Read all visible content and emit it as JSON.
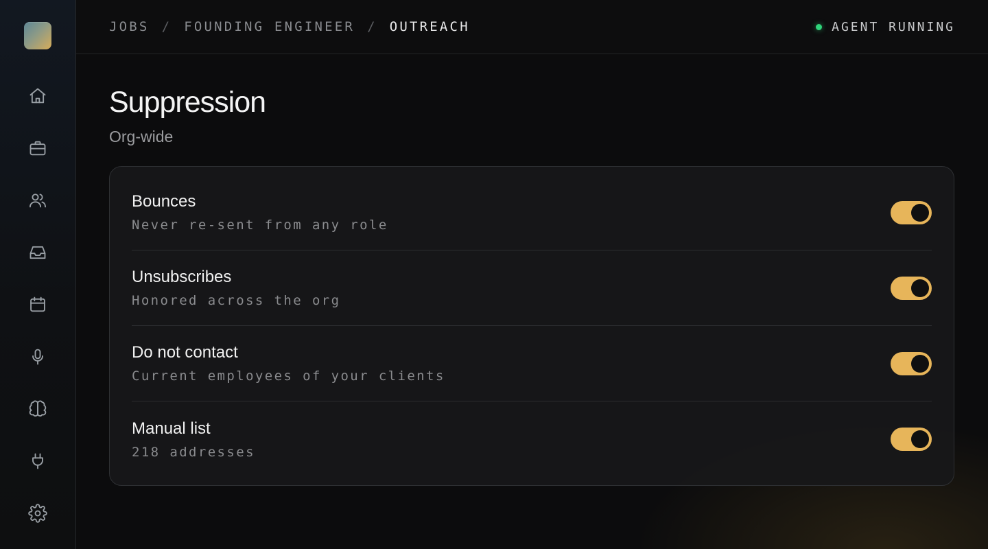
{
  "breadcrumb": {
    "items": [
      "JOBS",
      "FOUNDING ENGINEER",
      "OUTREACH"
    ],
    "separator": "/"
  },
  "status": {
    "label": "AGENT RUNNING",
    "dot_color": "#2fd47a"
  },
  "sidebar": {
    "icons": [
      "home-icon",
      "briefcase-icon",
      "users-icon",
      "inbox-icon",
      "calendar-icon",
      "microphone-icon",
      "brain-icon",
      "plug-icon",
      "gear-icon"
    ]
  },
  "page": {
    "title": "Suppression",
    "subtitle": "Org-wide"
  },
  "settings": {
    "rows": [
      {
        "title": "Bounces",
        "description": "Never re-sent from any role",
        "enabled": true
      },
      {
        "title": "Unsubscribes",
        "description": "Honored across the org",
        "enabled": true
      },
      {
        "title": "Do not contact",
        "description": "Current employees of your clients",
        "enabled": true
      },
      {
        "title": "Manual list",
        "description": "218 addresses",
        "enabled": true
      }
    ]
  },
  "colors": {
    "accent": "#e7b55a",
    "background": "#0c0c0d"
  }
}
